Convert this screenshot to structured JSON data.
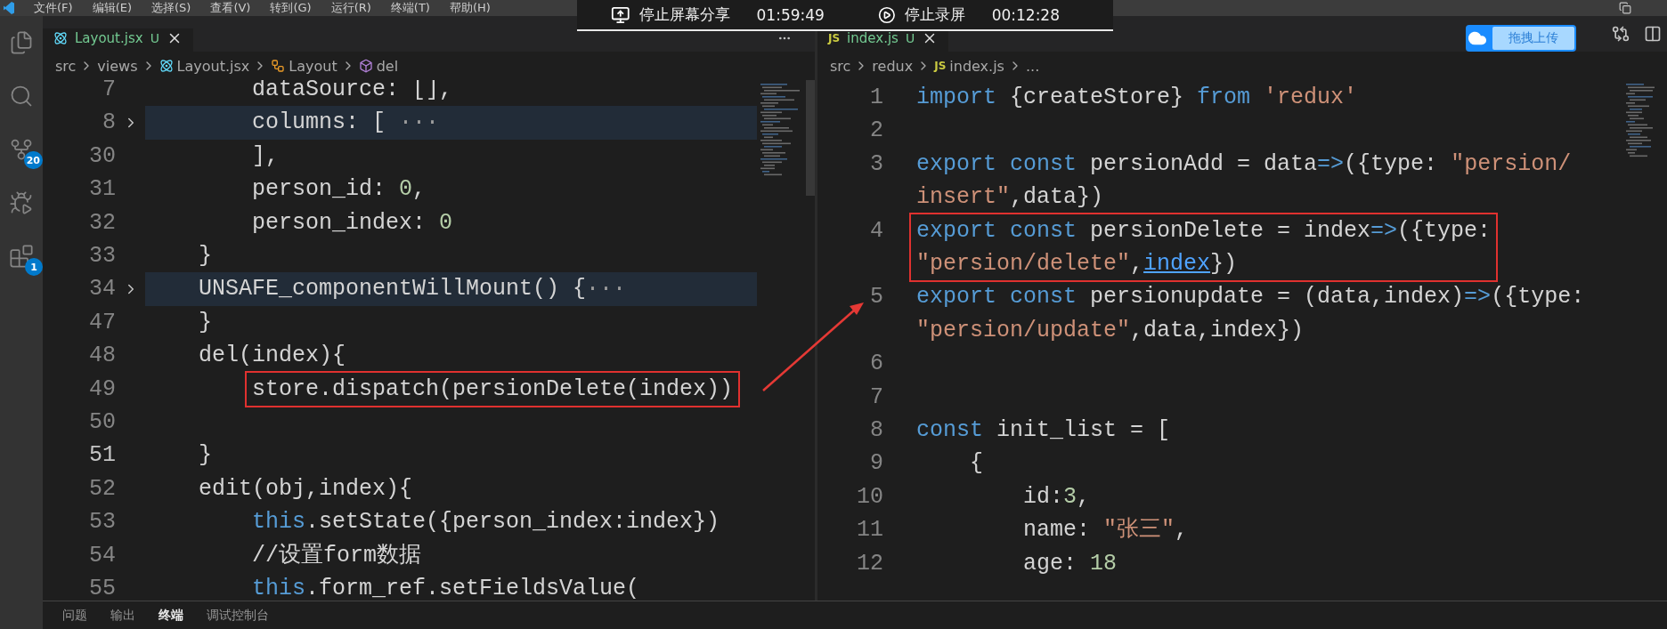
{
  "menu_bar": {
    "items": [
      "文件(F)",
      "编辑(E)",
      "选择(S)",
      "查看(V)",
      "转到(G)",
      "运行(R)",
      "终端(T)",
      "帮助(H)"
    ]
  },
  "recording_bar": {
    "share_label": "停止屏幕分享",
    "share_time": "01:59:49",
    "record_label": "停止录屏",
    "record_time": "00:12:28"
  },
  "upload_button": {
    "label": "拖拽上传"
  },
  "activity_bar": {
    "items": [
      {
        "kind": "explorer"
      },
      {
        "kind": "search"
      },
      {
        "kind": "source-control",
        "badge": "20"
      },
      {
        "kind": "run-debug"
      },
      {
        "kind": "extensions",
        "badge": "1"
      }
    ]
  },
  "editors": [
    {
      "tab": {
        "kind": "react",
        "label": "Layout.jsx",
        "status": "U"
      },
      "breadcrumb": [
        {
          "kind": "folder",
          "text": "src"
        },
        {
          "kind": "folder",
          "text": "views"
        },
        {
          "kind": "react-file",
          "text": "Layout.jsx"
        },
        {
          "kind": "class",
          "text": "Layout"
        },
        {
          "kind": "method",
          "text": "del"
        }
      ],
      "lines": [
        {
          "number": "7",
          "folded": false,
          "highlighted": false,
          "current": false,
          "boxed": false,
          "rows": [
            {
              "tokens": [
                {
                  "text": "        dataSource: [],",
                  "kind": "plain"
                }
              ]
            }
          ]
        },
        {
          "number": "8",
          "folded": true,
          "highlighted": true,
          "current": false,
          "boxed": false,
          "rows": [
            {
              "tokens": [
                {
                  "text": "        columns: [ ",
                  "kind": "plain"
                },
                {
                  "text": "···",
                  "kind": "fold"
                }
              ]
            }
          ]
        },
        {
          "number": "30",
          "folded": false,
          "highlighted": false,
          "current": false,
          "boxed": false,
          "rows": [
            {
              "tokens": [
                {
                  "text": "        ],",
                  "kind": "plain"
                }
              ]
            }
          ]
        },
        {
          "number": "31",
          "folded": false,
          "highlighted": false,
          "current": false,
          "boxed": false,
          "rows": [
            {
              "tokens": [
                {
                  "text": "        person_id: ",
                  "kind": "plain"
                },
                {
                  "text": "0",
                  "kind": "number"
                },
                {
                  "text": ",",
                  "kind": "plain"
                }
              ]
            }
          ]
        },
        {
          "number": "32",
          "folded": false,
          "highlighted": false,
          "current": false,
          "boxed": false,
          "rows": [
            {
              "tokens": [
                {
                  "text": "        person_index: ",
                  "kind": "plain"
                },
                {
                  "text": "0",
                  "kind": "number"
                }
              ]
            }
          ]
        },
        {
          "number": "33",
          "folded": false,
          "highlighted": false,
          "current": false,
          "boxed": false,
          "rows": [
            {
              "tokens": [
                {
                  "text": "    }",
                  "kind": "plain"
                }
              ]
            }
          ]
        },
        {
          "number": "34",
          "folded": true,
          "highlighted": true,
          "current": false,
          "boxed": false,
          "rows": [
            {
              "tokens": [
                {
                  "text": "    UNSAFE_componentWillMount() {",
                  "kind": "plain"
                },
                {
                  "text": "···",
                  "kind": "fold"
                }
              ]
            }
          ]
        },
        {
          "number": "47",
          "folded": false,
          "highlighted": false,
          "current": false,
          "boxed": false,
          "rows": [
            {
              "tokens": [
                {
                  "text": "    }",
                  "kind": "plain"
                }
              ]
            }
          ]
        },
        {
          "number": "48",
          "folded": false,
          "highlighted": false,
          "current": false,
          "boxed": false,
          "rows": [
            {
              "tokens": [
                {
                  "text": "    del(index){",
                  "kind": "plain"
                }
              ]
            }
          ]
        },
        {
          "number": "49",
          "folded": false,
          "highlighted": false,
          "current": false,
          "boxed": true,
          "rows": [
            {
              "tokens": [
                {
                  "text": "        store.dispatch(persionDelete(index))",
                  "kind": "plain"
                }
              ]
            }
          ]
        },
        {
          "number": "50",
          "folded": false,
          "highlighted": false,
          "current": false,
          "boxed": false
        },
        {
          "number": "51",
          "folded": false,
          "highlighted": false,
          "current": true,
          "boxed": false,
          "rows": [
            {
              "tokens": [
                {
                  "text": "    }",
                  "kind": "plain"
                }
              ]
            }
          ]
        },
        {
          "number": "52",
          "folded": false,
          "highlighted": false,
          "current": false,
          "boxed": false,
          "rows": [
            {
              "tokens": [
                {
                  "text": "    edit(obj,index){",
                  "kind": "plain"
                }
              ]
            }
          ]
        },
        {
          "number": "53",
          "folded": false,
          "highlighted": false,
          "current": false,
          "boxed": false,
          "rows": [
            {
              "tokens": [
                {
                  "text": "        this",
                  "kind": "keyword"
                },
                {
                  "text": ".setState({person_index:index})",
                  "kind": "plain"
                }
              ]
            }
          ]
        },
        {
          "number": "54",
          "folded": false,
          "highlighted": false,
          "current": false,
          "boxed": false,
          "rows": [
            {
              "tokens": [
                {
                  "text": "        //设置form数据",
                  "kind": "plain"
                }
              ]
            }
          ]
        },
        {
          "number": "55",
          "folded": false,
          "highlighted": false,
          "current": false,
          "boxed": false,
          "rows": [
            {
              "tokens": [
                {
                  "text": "        this",
                  "kind": "keyword"
                },
                {
                  "text": ".form_ref.setFieldsValue(",
                  "kind": "plain"
                }
              ]
            }
          ]
        }
      ]
    },
    {
      "tab": {
        "kind": "js",
        "type_label": "JS",
        "label": "index.js",
        "status": "U"
      },
      "breadcrumb": [
        {
          "kind": "folder",
          "text": "src"
        },
        {
          "kind": "folder",
          "text": "redux"
        },
        {
          "kind": "js-file",
          "type_label": "JS",
          "text": "index.js"
        },
        {
          "kind": "more",
          "text": "..."
        }
      ],
      "lines": [
        {
          "number": "1",
          "folded": false,
          "highlighted": false,
          "current": false,
          "boxed": false,
          "rows": [
            {
              "tokens": [
                {
                  "text": "import",
                  "kind": "keyword"
                },
                {
                  "text": " {createStore} ",
                  "kind": "plain"
                },
                {
                  "text": "from ",
                  "kind": "keyword"
                },
                {
                  "text": "'redux'",
                  "kind": "string"
                }
              ]
            }
          ]
        },
        {
          "number": "2",
          "folded": false,
          "highlighted": false,
          "current": false,
          "boxed": false
        },
        {
          "number": "3",
          "folded": false,
          "highlighted": false,
          "current": false,
          "boxed": false,
          "rows": [
            {
              "tokens": [
                {
                  "text": "export const",
                  "kind": "keyword"
                },
                {
                  "text": " persionAdd = data",
                  "kind": "plain"
                },
                {
                  "text": "=>",
                  "kind": "keyword"
                },
                {
                  "text": "({type: ",
                  "kind": "plain"
                },
                {
                  "text": "\"persion/",
                  "kind": "string"
                }
              ]
            },
            {
              "tokens": [
                {
                  "text": "insert\"",
                  "kind": "string"
                },
                {
                  "text": ",data})",
                  "kind": "plain"
                }
              ]
            }
          ]
        },
        {
          "number": "4",
          "folded": false,
          "highlighted": false,
          "current": false,
          "boxed": true,
          "rows": [
            {
              "tokens": [
                {
                  "text": "export const",
                  "kind": "keyword"
                },
                {
                  "text": " persionDelete = index",
                  "kind": "plain"
                },
                {
                  "text": "=>",
                  "kind": "keyword"
                },
                {
                  "text": "({type:",
                  "kind": "plain"
                }
              ]
            },
            {
              "tokens": [
                {
                  "text": "\"persion/delete\"",
                  "kind": "string"
                },
                {
                  "text": ",",
                  "kind": "plain"
                },
                {
                  "text": "index",
                  "kind": "link"
                },
                {
                  "text": "})",
                  "kind": "plain"
                }
              ]
            }
          ]
        },
        {
          "number": "5",
          "folded": false,
          "highlighted": false,
          "current": false,
          "boxed": false,
          "rows": [
            {
              "tokens": [
                {
                  "text": "export const",
                  "kind": "keyword"
                },
                {
                  "text": " persionupdate = (data,index)",
                  "kind": "plain"
                },
                {
                  "text": "=>",
                  "kind": "keyword"
                },
                {
                  "text": "({type:",
                  "kind": "plain"
                }
              ]
            },
            {
              "tokens": [
                {
                  "text": "\"persion/update\"",
                  "kind": "string"
                },
                {
                  "text": ",data,index})",
                  "kind": "plain"
                }
              ]
            }
          ]
        },
        {
          "number": "6",
          "folded": false,
          "highlighted": false,
          "current": false,
          "boxed": false
        },
        {
          "number": "7",
          "folded": false,
          "highlighted": false,
          "current": false,
          "boxed": false
        },
        {
          "number": "8",
          "folded": false,
          "highlighted": false,
          "current": false,
          "boxed": false,
          "rows": [
            {
              "tokens": [
                {
                  "text": "const",
                  "kind": "keyword"
                },
                {
                  "text": " init_list = [",
                  "kind": "plain"
                }
              ]
            }
          ]
        },
        {
          "number": "9",
          "folded": false,
          "highlighted": false,
          "current": false,
          "boxed": false,
          "rows": [
            {
              "tokens": [
                {
                  "text": "    {",
                  "kind": "plain"
                }
              ]
            }
          ]
        },
        {
          "number": "10",
          "folded": false,
          "highlighted": false,
          "current": false,
          "boxed": false,
          "rows": [
            {
              "tokens": [
                {
                  "text": "        id:",
                  "kind": "plain"
                },
                {
                  "text": "3",
                  "kind": "number"
                },
                {
                  "text": ",",
                  "kind": "plain"
                }
              ]
            }
          ]
        },
        {
          "number": "11",
          "folded": false,
          "highlighted": false,
          "current": false,
          "boxed": false,
          "rows": [
            {
              "tokens": [
                {
                  "text": "        name: ",
                  "kind": "plain"
                },
                {
                  "text": "\"张三\"",
                  "kind": "string"
                },
                {
                  "text": ",",
                  "kind": "plain"
                }
              ]
            }
          ]
        },
        {
          "number": "12",
          "folded": false,
          "highlighted": false,
          "current": false,
          "boxed": false,
          "rows": [
            {
              "tokens": [
                {
                  "text": "        age: ",
                  "kind": "plain"
                },
                {
                  "text": "18",
                  "kind": "number"
                }
              ]
            }
          ]
        }
      ]
    }
  ],
  "panel": {
    "tabs": [
      {
        "label": "问题",
        "selected": false
      },
      {
        "label": "输出",
        "selected": false
      },
      {
        "label": "终端",
        "selected": true
      },
      {
        "label": "调试控制台",
        "selected": false
      }
    ]
  }
}
